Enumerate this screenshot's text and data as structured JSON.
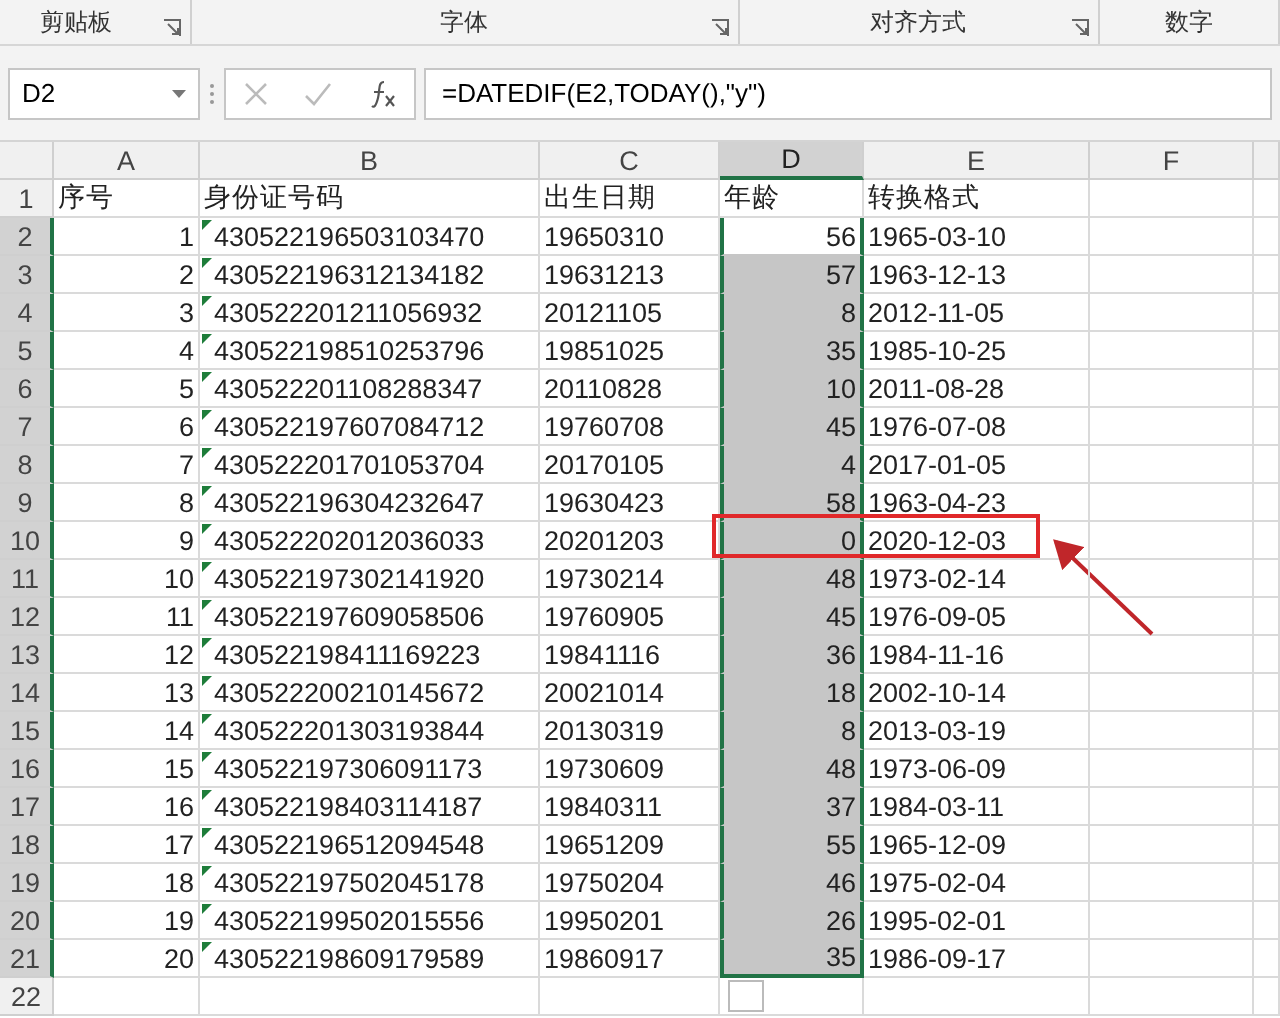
{
  "ribbon": {
    "groups": [
      {
        "label": "剪贴板",
        "launcher": true
      },
      {
        "label": "字体",
        "launcher": true
      },
      {
        "label": "对齐方式",
        "launcher": true
      },
      {
        "label": "数字",
        "launcher": false
      }
    ]
  },
  "formula_bar": {
    "name_box": "D2",
    "formula": "=DATEDIF(E2,TODAY(),\"y\")"
  },
  "sheet": {
    "columns": [
      {
        "label": "A",
        "selected": false
      },
      {
        "label": "B",
        "selected": false
      },
      {
        "label": "C",
        "selected": false
      },
      {
        "label": "D",
        "selected": true
      },
      {
        "label": "E",
        "selected": false
      },
      {
        "label": "F",
        "selected": false
      }
    ],
    "rows": [
      {
        "num": "1",
        "kind": "header",
        "cells": [
          "序号",
          "身份证号码",
          "出生日期",
          "年龄",
          "转换格式"
        ],
        "selected": false,
        "highlighted": false
      },
      {
        "num": "2",
        "kind": "data",
        "cells": [
          "1",
          "430522196503103470",
          "19650310",
          "56",
          "1965-03-10"
        ],
        "selected": true,
        "active": true,
        "highlighted": false
      },
      {
        "num": "3",
        "kind": "data",
        "cells": [
          "2",
          "430522196312134182",
          "19631213",
          "57",
          "1963-12-13"
        ],
        "selected": true,
        "active": false,
        "highlighted": false
      },
      {
        "num": "4",
        "kind": "data",
        "cells": [
          "3",
          "430522201211056932",
          "20121105",
          "8",
          "2012-11-05"
        ],
        "selected": true,
        "active": false,
        "highlighted": false
      },
      {
        "num": "5",
        "kind": "data",
        "cells": [
          "4",
          "430522198510253796",
          "19851025",
          "35",
          "1985-10-25"
        ],
        "selected": true,
        "active": false,
        "highlighted": false
      },
      {
        "num": "6",
        "kind": "data",
        "cells": [
          "5",
          "430522201108288347",
          "20110828",
          "10",
          "2011-08-28"
        ],
        "selected": true,
        "active": false,
        "highlighted": false
      },
      {
        "num": "7",
        "kind": "data",
        "cells": [
          "6",
          "430522197607084712",
          "19760708",
          "45",
          "1976-07-08"
        ],
        "selected": true,
        "active": false,
        "highlighted": false
      },
      {
        "num": "8",
        "kind": "data",
        "cells": [
          "7",
          "430522201701053704",
          "20170105",
          "4",
          "2017-01-05"
        ],
        "selected": true,
        "active": false,
        "highlighted": false
      },
      {
        "num": "9",
        "kind": "data",
        "cells": [
          "8",
          "430522196304232647",
          "19630423",
          "58",
          "1963-04-23"
        ],
        "selected": true,
        "active": false,
        "highlighted": false
      },
      {
        "num": "10",
        "kind": "data",
        "cells": [
          "9",
          "430522202012036033",
          "20201203",
          "0",
          "2020-12-03"
        ],
        "selected": true,
        "active": false,
        "highlighted": true
      },
      {
        "num": "11",
        "kind": "data",
        "cells": [
          "10",
          "430522197302141920",
          "19730214",
          "48",
          "1973-02-14"
        ],
        "selected": true,
        "active": false,
        "highlighted": false
      },
      {
        "num": "12",
        "kind": "data",
        "cells": [
          "11",
          "430522197609058506",
          "19760905",
          "45",
          "1976-09-05"
        ],
        "selected": true,
        "active": false,
        "highlighted": false
      },
      {
        "num": "13",
        "kind": "data",
        "cells": [
          "12",
          "430522198411169223",
          "19841116",
          "36",
          "1984-11-16"
        ],
        "selected": true,
        "active": false,
        "highlighted": false
      },
      {
        "num": "14",
        "kind": "data",
        "cells": [
          "13",
          "430522200210145672",
          "20021014",
          "18",
          "2002-10-14"
        ],
        "selected": true,
        "active": false,
        "highlighted": false
      },
      {
        "num": "15",
        "kind": "data",
        "cells": [
          "14",
          "430522201303193844",
          "20130319",
          "8",
          "2013-03-19"
        ],
        "selected": true,
        "active": false,
        "highlighted": false
      },
      {
        "num": "16",
        "kind": "data",
        "cells": [
          "15",
          "430522197306091173",
          "19730609",
          "48",
          "1973-06-09"
        ],
        "selected": true,
        "active": false,
        "highlighted": false
      },
      {
        "num": "17",
        "kind": "data",
        "cells": [
          "16",
          "430522198403114187",
          "19840311",
          "37",
          "1984-03-11"
        ],
        "selected": true,
        "active": false,
        "highlighted": false
      },
      {
        "num": "18",
        "kind": "data",
        "cells": [
          "17",
          "430522196512094548",
          "19651209",
          "55",
          "1965-12-09"
        ],
        "selected": true,
        "active": false,
        "highlighted": false
      },
      {
        "num": "19",
        "kind": "data",
        "cells": [
          "18",
          "430522197502045178",
          "19750204",
          "46",
          "1975-02-04"
        ],
        "selected": true,
        "active": false,
        "highlighted": false
      },
      {
        "num": "20",
        "kind": "data",
        "cells": [
          "19",
          "430522199502015556",
          "19950201",
          "26",
          "1995-02-01"
        ],
        "selected": true,
        "active": false,
        "highlighted": false
      },
      {
        "num": "21",
        "kind": "data",
        "cells": [
          "20",
          "430522198609179589",
          "19860917",
          "35",
          "1986-09-17"
        ],
        "selected": true,
        "active": false,
        "highlighted": false
      }
    ],
    "empty_rows": [
      "22"
    ]
  }
}
